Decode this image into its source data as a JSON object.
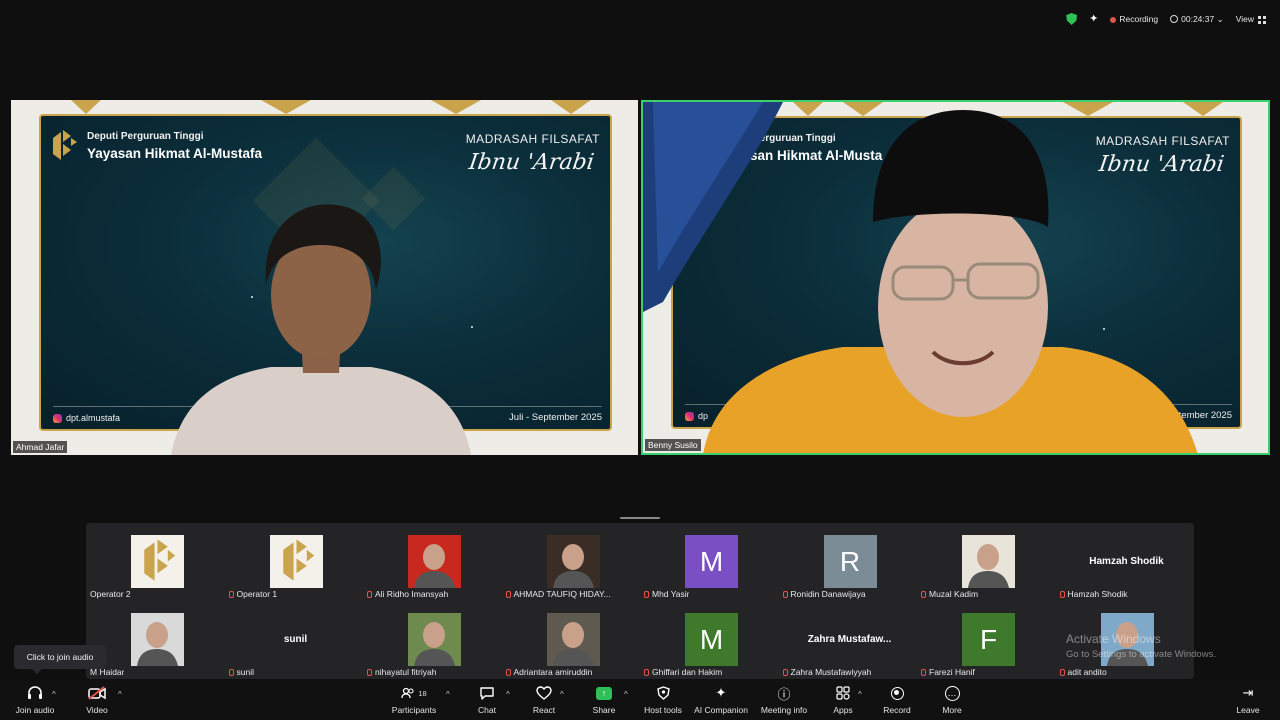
{
  "status": {
    "recording_label": "Recording",
    "timer": "00:24:37",
    "view_label": "View",
    "chevron": "⌄"
  },
  "banner": {
    "deputi": "Deputi Perguruan Tinggi",
    "yayasan": "Yayasan Hikmat Al-Mustafa",
    "madrasah": "MADRASAH FILSAFAT",
    "ibnu": "Ibnu 'Arabi",
    "instagram": "dpt.almustafa",
    "period": "Juli - September 2025",
    "right_deputi": "Perguruan Tinggi",
    "right_yayasan": "yasan Hikmat Al-Musta",
    "right_instagram": "dp",
    "right_period": "- September 2025"
  },
  "videos": [
    {
      "name": "Ahmad Jafar"
    },
    {
      "name": "Benny Susilo"
    }
  ],
  "gallery": [
    {
      "name": "Operator 2",
      "type": "logo",
      "muted": false
    },
    {
      "name": "Operator 1",
      "type": "logo",
      "muted": true
    },
    {
      "name": "Ali Ridho Imansyah",
      "type": "photo",
      "bg": "#c9281f",
      "muted": true
    },
    {
      "name": "AHMAD TAUFIQ HIDAY...",
      "type": "photo",
      "bg": "#3a2d25",
      "muted": true
    },
    {
      "name": "Mhd Yasir",
      "type": "letter",
      "letter": "M",
      "bg": "#7b4fc4",
      "muted": true
    },
    {
      "name": "Ronidin Danawijaya",
      "type": "letter",
      "letter": "R",
      "bg": "#7b8c96",
      "muted": true
    },
    {
      "name": "Muzal Kadim",
      "type": "photo",
      "bg": "#e9e4da",
      "muted": true
    },
    {
      "name": "Hamzah Shodik",
      "type": "text",
      "big": "Hamzah Shodik",
      "muted": true
    },
    {
      "name": "M Haidar",
      "type": "photo",
      "bg": "#d9d9d9",
      "muted": false
    },
    {
      "name": "sunil",
      "type": "text",
      "big": "sunil",
      "muted": true
    },
    {
      "name": "nihayatul fitriyah",
      "type": "photo",
      "bg": "#6f8a4e",
      "muted": true
    },
    {
      "name": "Adriantara amiruddin",
      "type": "photo",
      "bg": "#5f5a4f",
      "muted": true
    },
    {
      "name": "Ghiffari dan Hakim",
      "type": "letter",
      "letter": "M",
      "bg": "#3f7a2c",
      "muted": true
    },
    {
      "name": "Zahra Mustafawiyyah",
      "type": "text",
      "big": "Zahra Mustafaw...",
      "muted": true
    },
    {
      "name": "Farezi Hanif",
      "type": "letter",
      "letter": "F",
      "bg": "#3f7a2c",
      "muted": true
    },
    {
      "name": "adit andito",
      "type": "photo",
      "bg": "#7fa9c9",
      "muted": true
    }
  ],
  "watermark": {
    "line1": "Activate Windows",
    "line2": "Go to Settings to activate Windows."
  },
  "tooltip": "Click to join audio",
  "toolbar": {
    "join_audio": "Join audio",
    "video": "Video",
    "participants": "Participants",
    "participants_count": "18",
    "chat": "Chat",
    "react": "React",
    "share": "Share",
    "host_tools": "Host tools",
    "ai_companion": "AI Companion",
    "meeting_info": "Meeting info",
    "apps": "Apps",
    "record": "Record",
    "more": "More",
    "leave": "Leave"
  },
  "icons": {
    "headphones": "🎧",
    "video_off": "📹",
    "participants": "👥",
    "chat": "💬",
    "react": "♡",
    "share": "↑",
    "shield": "🛡",
    "spark": "✦",
    "info": "ⓘ",
    "apps": "⊞",
    "more": "…",
    "leave": "⇥",
    "caret": "^"
  }
}
